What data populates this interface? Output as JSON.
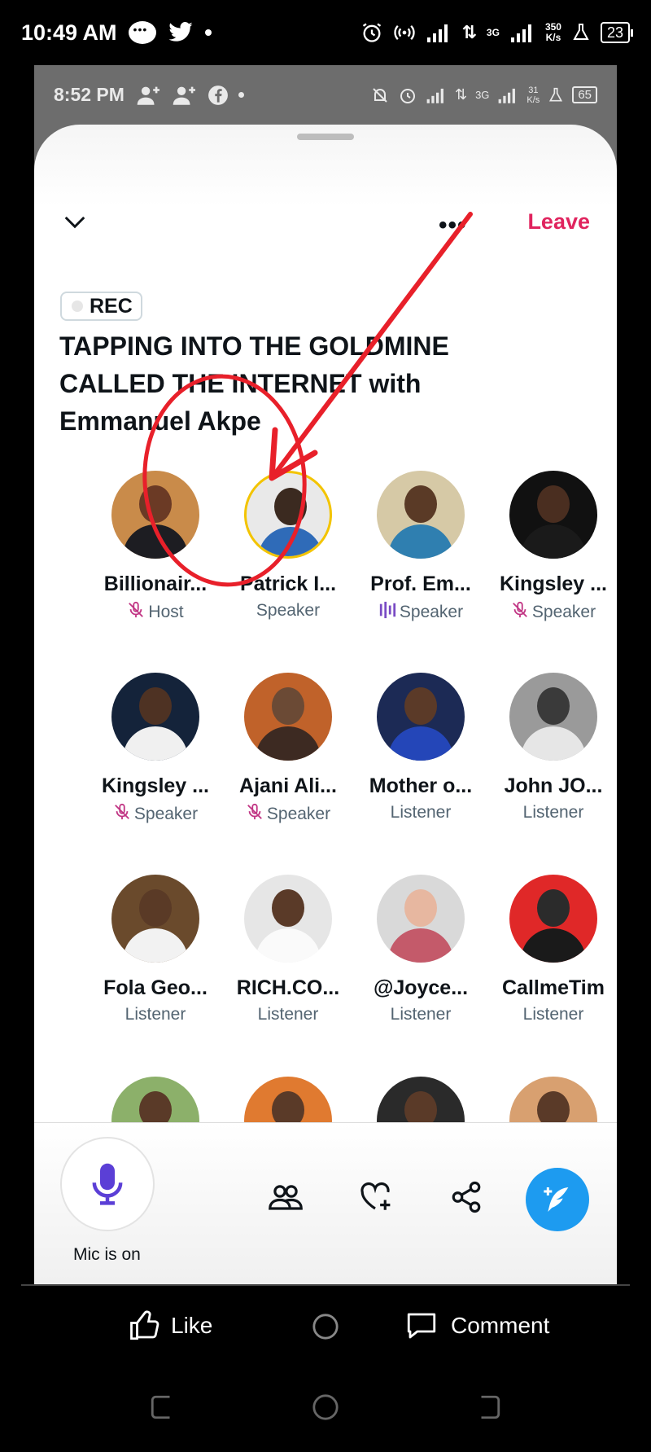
{
  "outer_status": {
    "time": "10:49 AM",
    "speed_top": "350",
    "speed_unit": "K/s",
    "network": "3G",
    "battery": "23"
  },
  "inner_status": {
    "time": "8:52 PM",
    "speed_top": "31",
    "speed_unit": "K/s",
    "network": "3G",
    "battery": "65"
  },
  "space": {
    "leave_label": "Leave",
    "rec_label": "REC",
    "title": "TAPPING INTO THE GOLDMINE CALLED THE INTERNET with Emmanuel Akpe"
  },
  "participants": [
    {
      "name": "Billionair...",
      "role": "Host",
      "mic": "muted",
      "colors": [
        "#c98b4a",
        "#1d1d22",
        "#6b3a25"
      ]
    },
    {
      "name": "Patrick I...",
      "role": "Speaker",
      "mic": "none",
      "colors": [
        "#e9e9e9",
        "#2f6bb8",
        "#3b2a20"
      ]
    },
    {
      "name": "Prof. Em...",
      "role": "Speaker",
      "mic": "speaking",
      "colors": [
        "#d6c9a6",
        "#2f7fb0",
        "#5a3a26"
      ]
    },
    {
      "name": "Kingsley ...",
      "role": "Speaker",
      "mic": "muted",
      "colors": [
        "#111111",
        "#1a1a1a",
        "#4a2e20"
      ]
    },
    {
      "name": "Kingsley ...",
      "role": "Speaker",
      "mic": "muted",
      "colors": [
        "#14233a",
        "#f0f0f0",
        "#4e3223"
      ]
    },
    {
      "name": "Ajani Ali...",
      "role": "Speaker",
      "mic": "muted",
      "colors": [
        "#c0622a",
        "#3d2a22",
        "#6b4a35"
      ]
    },
    {
      "name": "Mother o...",
      "role": "Listener",
      "mic": "none",
      "colors": [
        "#1c2a55",
        "#2446b8",
        "#5b3a28"
      ]
    },
    {
      "name": "John JO...",
      "role": "Listener",
      "mic": "none",
      "colors": [
        "#9a9a9a",
        "#e6e6e6",
        "#3a3a3a"
      ]
    },
    {
      "name": "Fola Geo...",
      "role": "Listener",
      "mic": "none",
      "colors": [
        "#6a4a2c",
        "#f2f2f2",
        "#5a3a26"
      ]
    },
    {
      "name": "RICH.CO...",
      "role": "Listener",
      "mic": "none",
      "colors": [
        "#e6e6e6",
        "#fafafa",
        "#5a3a28"
      ]
    },
    {
      "name": "@Joyce...",
      "role": "Listener",
      "mic": "none",
      "colors": [
        "#d9d9d9",
        "#c45a6a",
        "#e7b7a0"
      ]
    },
    {
      "name": "CallmeTim",
      "role": "Listener",
      "mic": "none",
      "colors": [
        "#e02828",
        "#1a1a1a",
        "#2b2b2b"
      ]
    }
  ],
  "partial_row_colors": [
    "#8cb06a",
    "#e07a30",
    "#2a2a2a",
    "#d8a070"
  ],
  "bottom_bar": {
    "mic_label": "Mic is on"
  },
  "outer_bottom": {
    "like_label": "Like",
    "comment_label": "Comment"
  },
  "colors": {
    "accent": "#1d9bf0",
    "leave": "#e0245e",
    "mic": "#794bc4",
    "annotation": "#e8202a"
  }
}
